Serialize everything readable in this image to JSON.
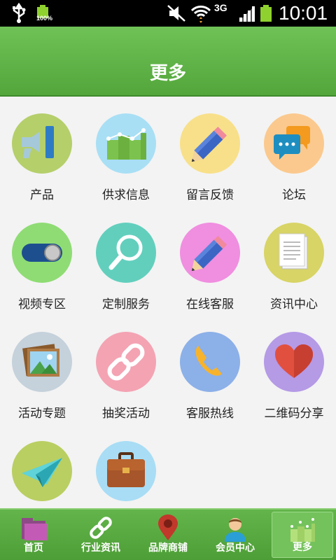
{
  "status_bar": {
    "battery_small_pct": "100%",
    "network": "3G",
    "time": "10:01"
  },
  "header": {
    "title": "更多"
  },
  "grid": {
    "items": [
      {
        "label": "产品",
        "icon": "megaphone-icon",
        "bg": "#b5cf6b"
      },
      {
        "label": "供求信息",
        "icon": "bar-chart-icon",
        "bg": "#a8dff5"
      },
      {
        "label": "留言反馈",
        "icon": "pencil-icon",
        "bg": "#f8e08a"
      },
      {
        "label": "论坛",
        "icon": "chat-bubbles-icon",
        "bg": "#fbc98e"
      },
      {
        "label": "视频专区",
        "icon": "toggle-switch-icon",
        "bg": "#8fdc74"
      },
      {
        "label": "定制服务",
        "icon": "magnifier-icon",
        "bg": "#62cfbd"
      },
      {
        "label": "在线客服",
        "icon": "pencil-icon",
        "bg": "#f08ee0"
      },
      {
        "label": "资讯中心",
        "icon": "document-icon",
        "bg": "#d8d466"
      },
      {
        "label": "活动专题",
        "icon": "photo-icon",
        "bg": "#c5d1db"
      },
      {
        "label": "抽奖活动",
        "icon": "link-icon",
        "bg": "#f4a3b3"
      },
      {
        "label": "客服热线",
        "icon": "phone-icon",
        "bg": "#8cb0e8"
      },
      {
        "label": "二维码分享",
        "icon": "heart-icon",
        "bg": "#b59ae6"
      },
      {
        "label": "",
        "icon": "paper-plane-icon",
        "bg": "#b9cf62"
      },
      {
        "label": "",
        "icon": "briefcase-icon",
        "bg": "#a8ddf5"
      }
    ]
  },
  "bottom_nav": {
    "items": [
      {
        "label": "首页",
        "icon": "folder-icon"
      },
      {
        "label": "行业资讯",
        "icon": "link-icon"
      },
      {
        "label": "品牌商铺",
        "icon": "map-pin-icon"
      },
      {
        "label": "会员中心",
        "icon": "user-icon"
      },
      {
        "label": "更多",
        "icon": "bar-chart-icon",
        "active": true
      }
    ]
  },
  "colors": {
    "header_green": "#5bb044",
    "status_bar": "#000000",
    "page_bg": "#f3f3f3"
  }
}
